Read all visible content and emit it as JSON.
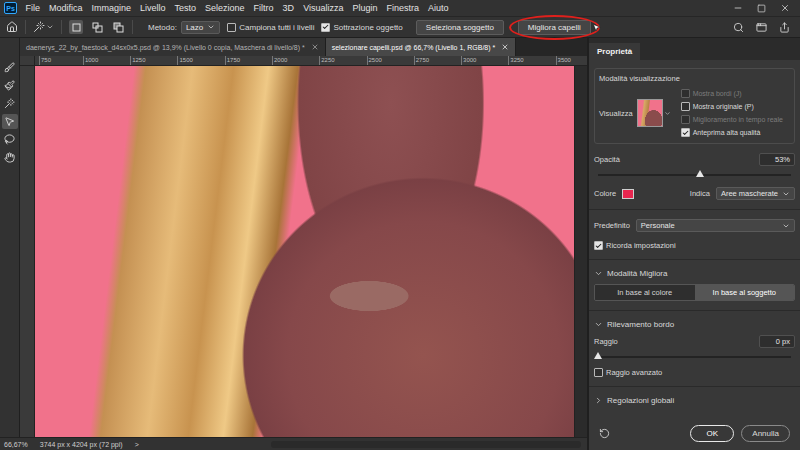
{
  "app_logo": "Ps",
  "menu": [
    "File",
    "Modifica",
    "Immagine",
    "Livello",
    "Testo",
    "Selezione",
    "Filtro",
    "3D",
    "Visualizza",
    "Plugin",
    "Finestra",
    "Aiuto"
  ],
  "options_bar": {
    "selection_modes": [
      {
        "kind": "new",
        "selected": true
      },
      {
        "kind": "add",
        "selected": false
      },
      {
        "kind": "subtract",
        "selected": false
      }
    ],
    "method_label": "Metodo:",
    "method": "Lazo",
    "checkboxes": [
      {
        "label": "Campiona tutti i livelli",
        "checked": false
      },
      {
        "label": "Sottrazione oggetto",
        "checked": true
      }
    ],
    "buttons": [
      {
        "label": "Seleziona soggetto",
        "circled": false
      },
      {
        "label": "Migliora capelli",
        "circled": true
      }
    ]
  },
  "tabs": [
    {
      "label": "daenerys_22_by_faestock_d4sx0x5.psd @ 13,9% (Livello 0 copia, Maschera di livello/8) *",
      "selected": false
    },
    {
      "label": "selezionare capelli.psd @ 66,7% (Livello 1, RGB/8) *",
      "selected": true
    }
  ],
  "tools": [
    {
      "kind": "refine-brush",
      "selected": false
    },
    {
      "kind": "brush",
      "selected": false
    },
    {
      "kind": "quick-select",
      "selected": false
    },
    {
      "kind": "object-select",
      "selected": true
    },
    {
      "kind": "lasso",
      "selected": false
    },
    {
      "kind": "hand",
      "selected": false
    }
  ],
  "ruler": [
    "750",
    "1000",
    "1250",
    "1500",
    "1750",
    "2000",
    "2250",
    "2500",
    "2750",
    "3000",
    "3250",
    "3500"
  ],
  "status_bar": {
    "zoom": "66,67%",
    "size": "3744 px x 4204 px (72 ppi)",
    "arrow": ">"
  },
  "properties": {
    "title": "Proprietà",
    "view_mode": {
      "title": "Modalità visualizzazione",
      "label": "Visualizza",
      "options": [
        {
          "label": "Mostra bordi (J)",
          "checked": false,
          "disabled": true
        },
        {
          "label": "Mostra originale (P)",
          "checked": false,
          "disabled": false
        },
        {
          "label": "Miglioramento in tempo reale",
          "checked": false,
          "disabled": true
        },
        {
          "label": "Anteprima alta qualità",
          "checked": true,
          "disabled": false
        }
      ]
    },
    "opacity": {
      "label": "Opacità",
      "level": 0.53,
      "reading": "53%"
    },
    "color": {
      "label": "Colore",
      "value": "#e8264f"
    },
    "indicate": {
      "label": "Indica",
      "value": "Aree mascherate"
    },
    "preset": {
      "label": "Predefinito",
      "value": "Personale"
    },
    "remember": {
      "label": "Ricorda impostazioni",
      "checked": true
    },
    "sections": [
      {
        "title": "Modalità Migliora",
        "expanded": true,
        "kind": "segmented",
        "options": [
          {
            "label": "In base al colore",
            "selected": false
          },
          {
            "label": "In base al soggetto",
            "selected": true
          }
        ]
      },
      {
        "title": "Rilevamento bordo",
        "expanded": true,
        "kind": "radius",
        "slider": {
          "label": "Raggio",
          "level": 0,
          "reading": "0 px"
        },
        "checkbox": {
          "label": "Raggio avanzato",
          "checked": false
        }
      },
      {
        "title": "Regolazioni globali",
        "expanded": false,
        "kind": "collapsed"
      }
    ],
    "buttons": [
      {
        "label": "OK",
        "primary": true
      },
      {
        "label": "Annulla",
        "primary": false
      }
    ]
  }
}
